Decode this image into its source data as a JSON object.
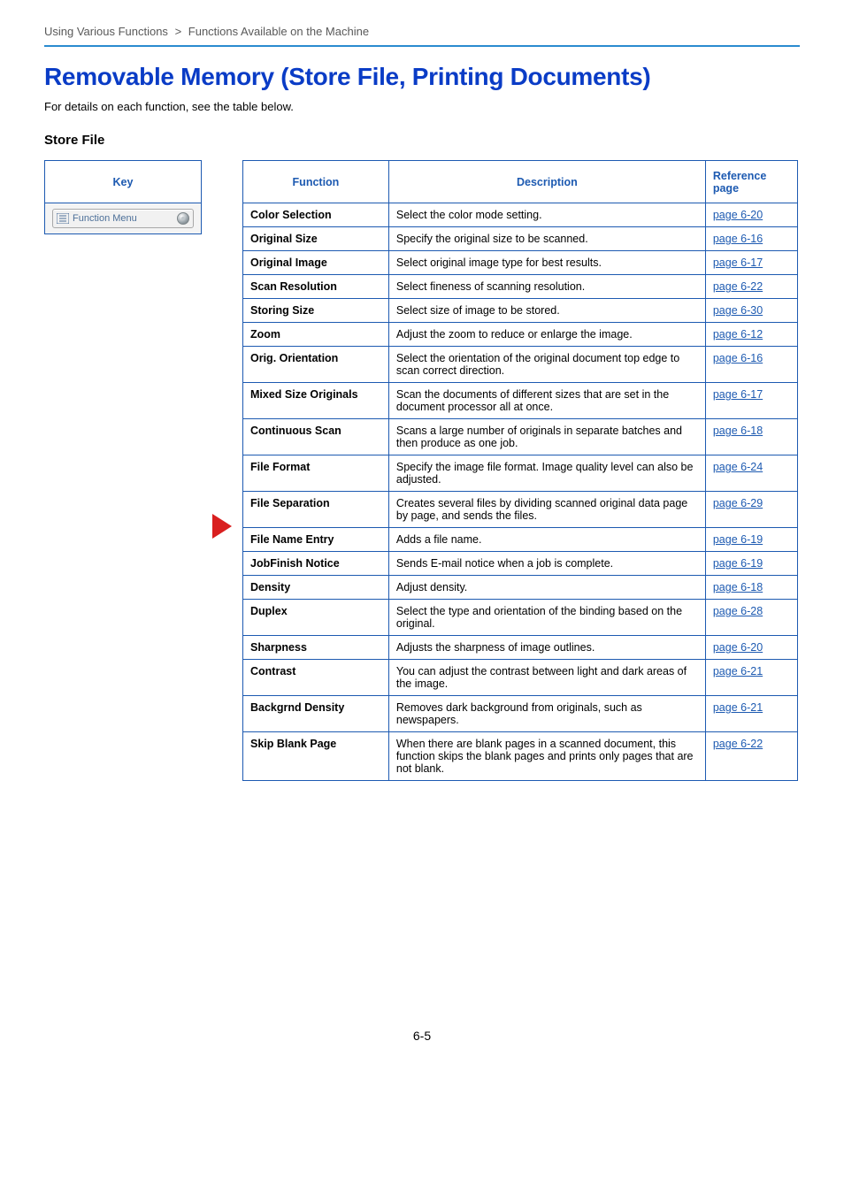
{
  "breadcrumb": {
    "section": "Using Various Functions",
    "separator": ">",
    "sub": "Functions Available on the Machine"
  },
  "heading": "Removable Memory (Store File, Printing Documents)",
  "intro": "For details on each function, see the table below.",
  "subheading": "Store File",
  "key_table": {
    "header": "Key",
    "button_label": "Function Menu"
  },
  "fn_table": {
    "headers": {
      "function": "Function",
      "description": "Description",
      "ref": "Reference page"
    },
    "rows": [
      {
        "fn": "Color Selection",
        "desc": "Select the color mode setting.",
        "ref": "page 6-20"
      },
      {
        "fn": "Original Size",
        "desc": "Specify the original size to be scanned.",
        "ref": "page 6-16"
      },
      {
        "fn": "Original Image",
        "desc": "Select original image type for best results.",
        "ref": "page 6-17"
      },
      {
        "fn": "Scan Resolution",
        "desc": "Select fineness of scanning resolution.",
        "ref": "page 6-22"
      },
      {
        "fn": "Storing Size",
        "desc": "Select size of image to be stored.",
        "ref": "page 6-30"
      },
      {
        "fn": "Zoom",
        "desc": "Adjust the zoom to reduce or enlarge the image.",
        "ref": "page 6-12"
      },
      {
        "fn": "Orig. Orientation",
        "desc": "Select the orientation of the original document top edge to scan correct direction.",
        "ref": "page 6-16"
      },
      {
        "fn": "Mixed Size Originals",
        "desc": "Scan the documents of different sizes that are set in the document processor all at once.",
        "ref": "page 6-17"
      },
      {
        "fn": "Continuous Scan",
        "desc": "Scans a large number of originals in separate batches and then produce as one job.",
        "ref": "page 6-18"
      },
      {
        "fn": "File Format",
        "desc": "Specify the image file format. Image quality level can also be adjusted.",
        "ref": "page 6-24"
      },
      {
        "fn": "File Separation",
        "desc": "Creates several files by dividing scanned original data page by page, and sends the files.",
        "ref": "page 6-29"
      },
      {
        "fn": "File Name Entry",
        "desc": "Adds a file name.",
        "ref": "page 6-19"
      },
      {
        "fn": "JobFinish Notice",
        "desc": "Sends E-mail notice when a job is complete.",
        "ref": "page 6-19"
      },
      {
        "fn": "Density",
        "desc": "Adjust density.",
        "ref": "page 6-18"
      },
      {
        "fn": "Duplex",
        "desc": "Select the type and orientation of the binding based on the original.",
        "ref": "page 6-28"
      },
      {
        "fn": "Sharpness",
        "desc": "Adjusts the sharpness of image outlines.",
        "ref": "page 6-20"
      },
      {
        "fn": "Contrast",
        "desc": "You can adjust the contrast between light and dark areas of the image.",
        "ref": "page 6-21"
      },
      {
        "fn": "Backgrnd Density",
        "desc": "Removes dark background from originals, such as newspapers.",
        "ref": "page 6-21"
      },
      {
        "fn": "Skip Blank Page",
        "desc": "When there are blank pages in a scanned document, this function skips the blank pages and prints only pages that are not blank.",
        "ref": "page 6-22"
      }
    ]
  },
  "page_number": "6-5"
}
